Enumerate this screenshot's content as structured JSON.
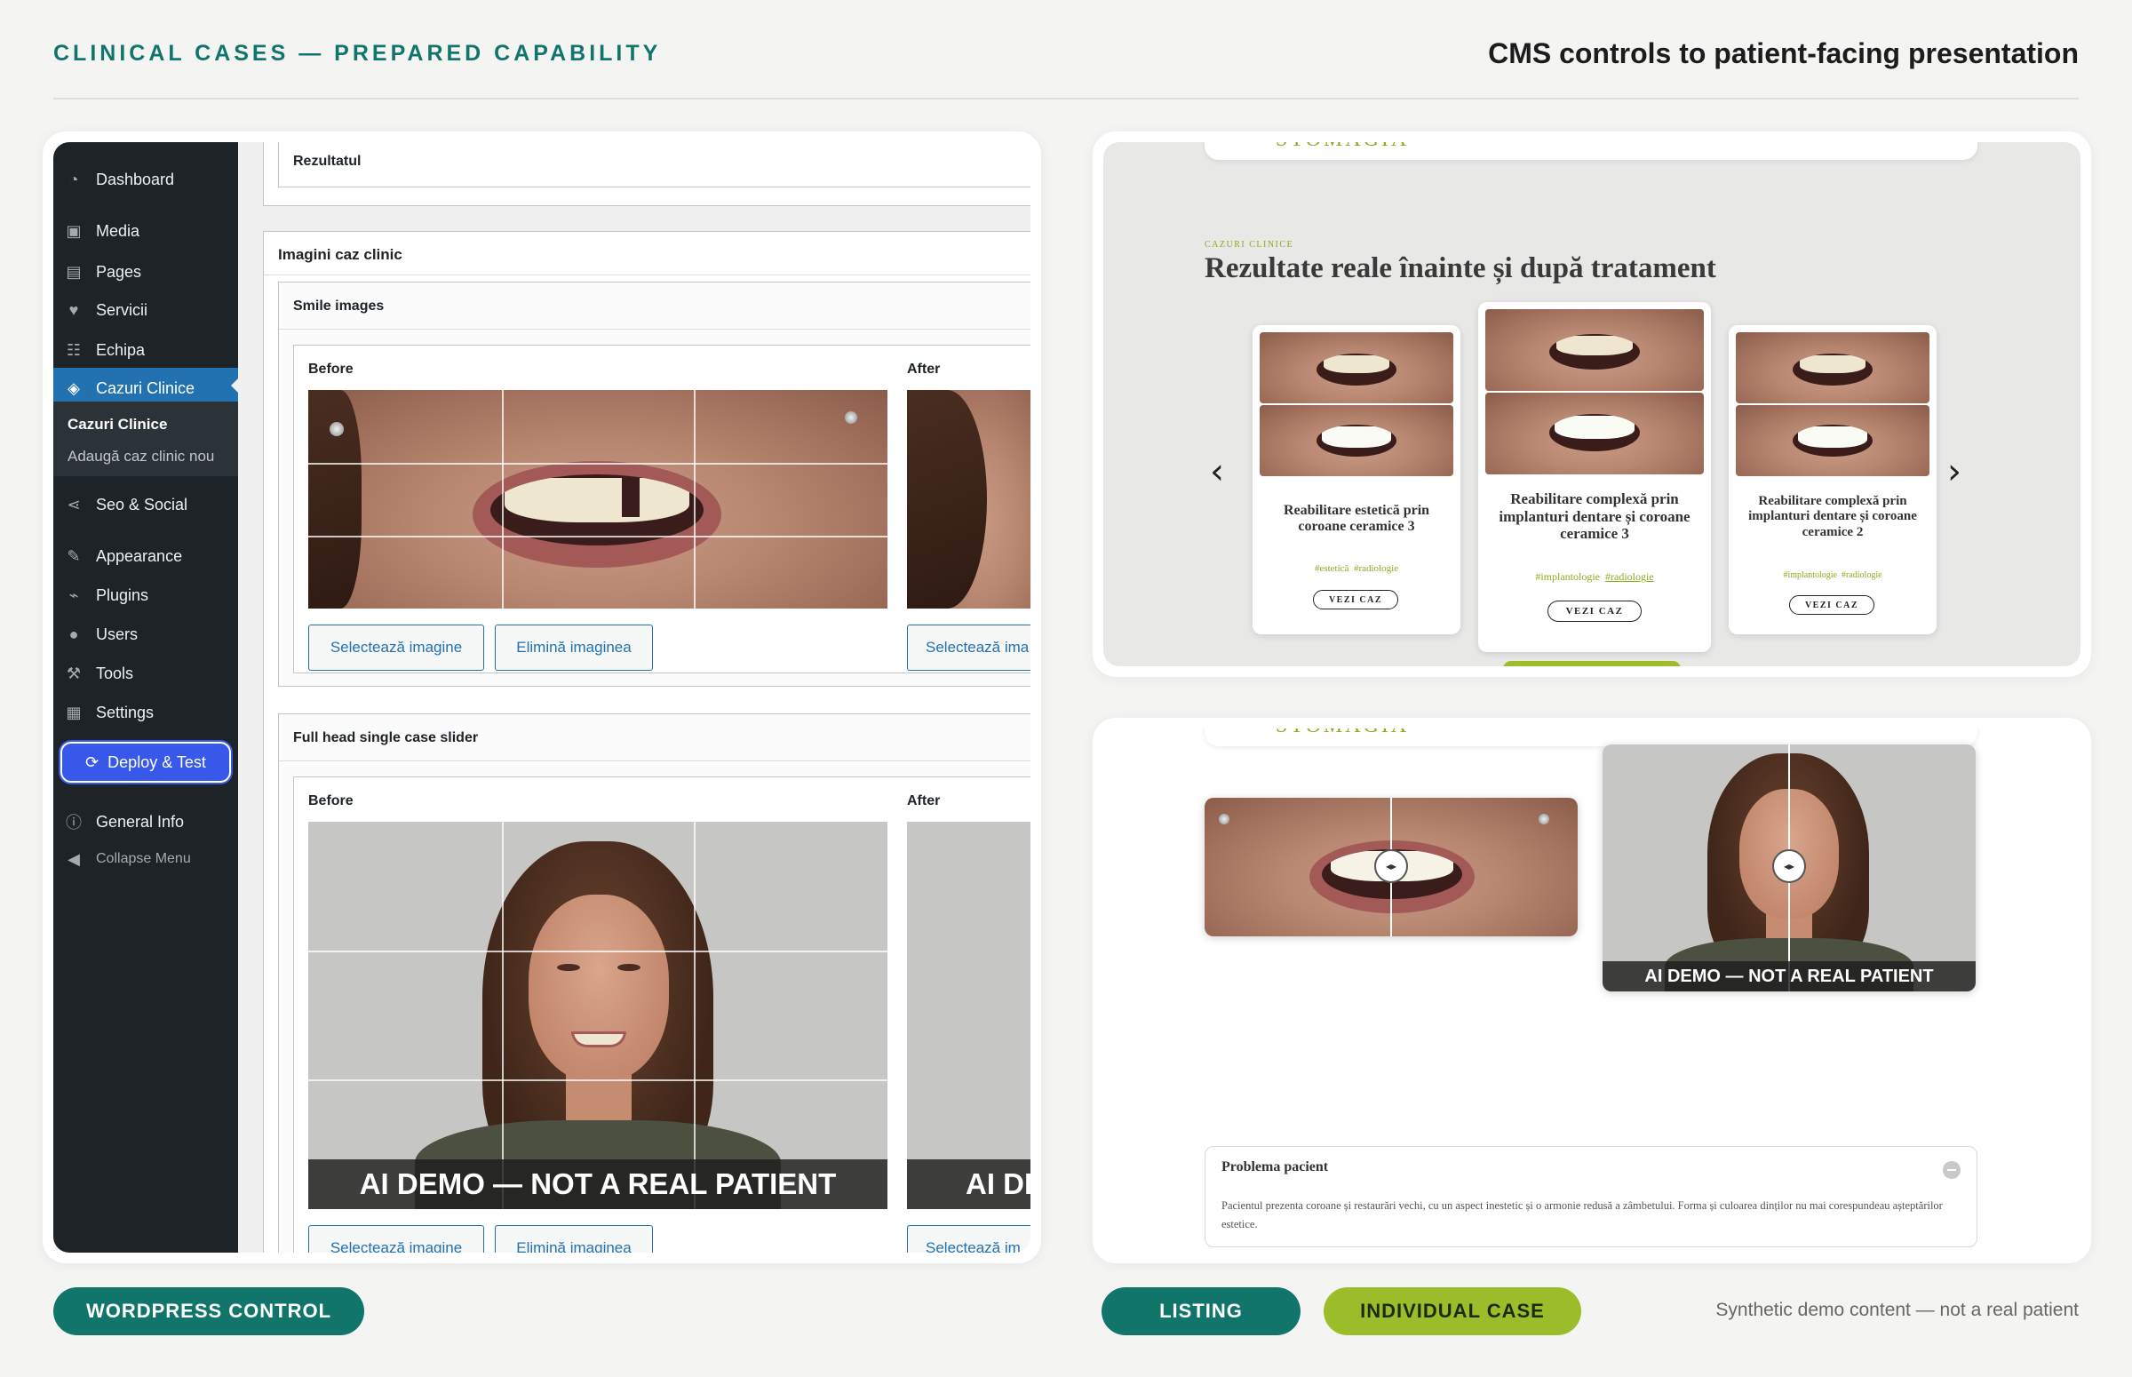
{
  "header": {
    "left_title": "CLINICAL CASES — PREPARED CAPABILITY",
    "right_title": "CMS controls to patient-facing presentation"
  },
  "wp": {
    "menu": [
      {
        "label": "Dashboard",
        "icon": "dashboard-icon"
      },
      {
        "label": "Media",
        "icon": "media-icon"
      },
      {
        "label": "Pages",
        "icon": "pages-icon"
      },
      {
        "label": "Servicii",
        "icon": "heart-icon"
      },
      {
        "label": "Echipa",
        "icon": "team-icon"
      },
      {
        "label": "Cazuri Clinice",
        "icon": "tooth-icon"
      },
      {
        "label": "Seo & Social",
        "icon": "share-icon"
      },
      {
        "label": "Appearance",
        "icon": "brush-icon"
      },
      {
        "label": "Plugins",
        "icon": "plugin-icon"
      },
      {
        "label": "Users",
        "icon": "user-icon"
      },
      {
        "label": "Tools",
        "icon": "wrench-icon"
      },
      {
        "label": "Settings",
        "icon": "settings-icon"
      },
      {
        "label": "General Info",
        "icon": "info-icon"
      },
      {
        "label": "Collapse Menu",
        "icon": "collapse-icon"
      }
    ],
    "submenu": {
      "current": "Cazuri Clinice",
      "add_new": "Adaugă caz clinic nou"
    },
    "deploy_label": "Deploy & Test",
    "result_title": "Rezultatul",
    "images_box_title": "Imagini caz clinic",
    "smile_section": "Smile images",
    "fullhead_section": "Full head single case slider",
    "before_label": "Before",
    "after_label": "After",
    "select_image": "Selectează imagine",
    "select_image_cut": "Selectează ima",
    "select_image_cut2": "Selectează im",
    "remove_image": "Elimină imaginea",
    "demo_banner": "AI DEMO — NOT A REAL PATIENT",
    "demo_banner_cut": "AI DI"
  },
  "listing": {
    "logo": "STOMAGIA",
    "eyebrow": "CAZURI CLINICE",
    "title": "Rezultate reale înainte și după tratament",
    "prev_arrow": "‹",
    "next_arrow": "›",
    "cards": [
      {
        "title": "Reabilitare estetică prin coroane ceramice 3",
        "tags": [
          "#estetică",
          "#radiologie"
        ],
        "button": "VEZI CAZ"
      },
      {
        "title": "Reabilitare complexă prin implanturi dentare și coroane ceramice 3",
        "tags": [
          "#implantologie",
          "#radiologie"
        ],
        "button": "VEZI CAZ"
      },
      {
        "title": "Reabilitare complexă prin implanturi dentare și coroane ceramice 2",
        "tags": [
          "#implantologie",
          "#radiologie"
        ],
        "button": "VEZI CAZ"
      }
    ]
  },
  "case_page": {
    "logo": "STOMAGIA",
    "demo_banner": "AI DEMO — NOT A REAL PATIENT",
    "accordion_title": "Problema pacient",
    "accordion_body": "Pacientul prezenta coroane și restaurări vechi, cu un aspect inestetic și o armonie redusă a zâmbetului. Forma și culoarea dinților nu mai corespundeau așteptărilor estetice."
  },
  "footer": {
    "wp_pill": "WORDPRESS CONTROL",
    "listing_pill": "LISTING",
    "case_pill": "INDIVIDUAL CASE",
    "disclaimer": "Synthetic demo content — not a real patient"
  },
  "colors": {
    "brand_teal": "#12756b",
    "brand_lime": "#9cbd2a",
    "wp_blue": "#2271b1",
    "wp_dark": "#1d2327"
  }
}
